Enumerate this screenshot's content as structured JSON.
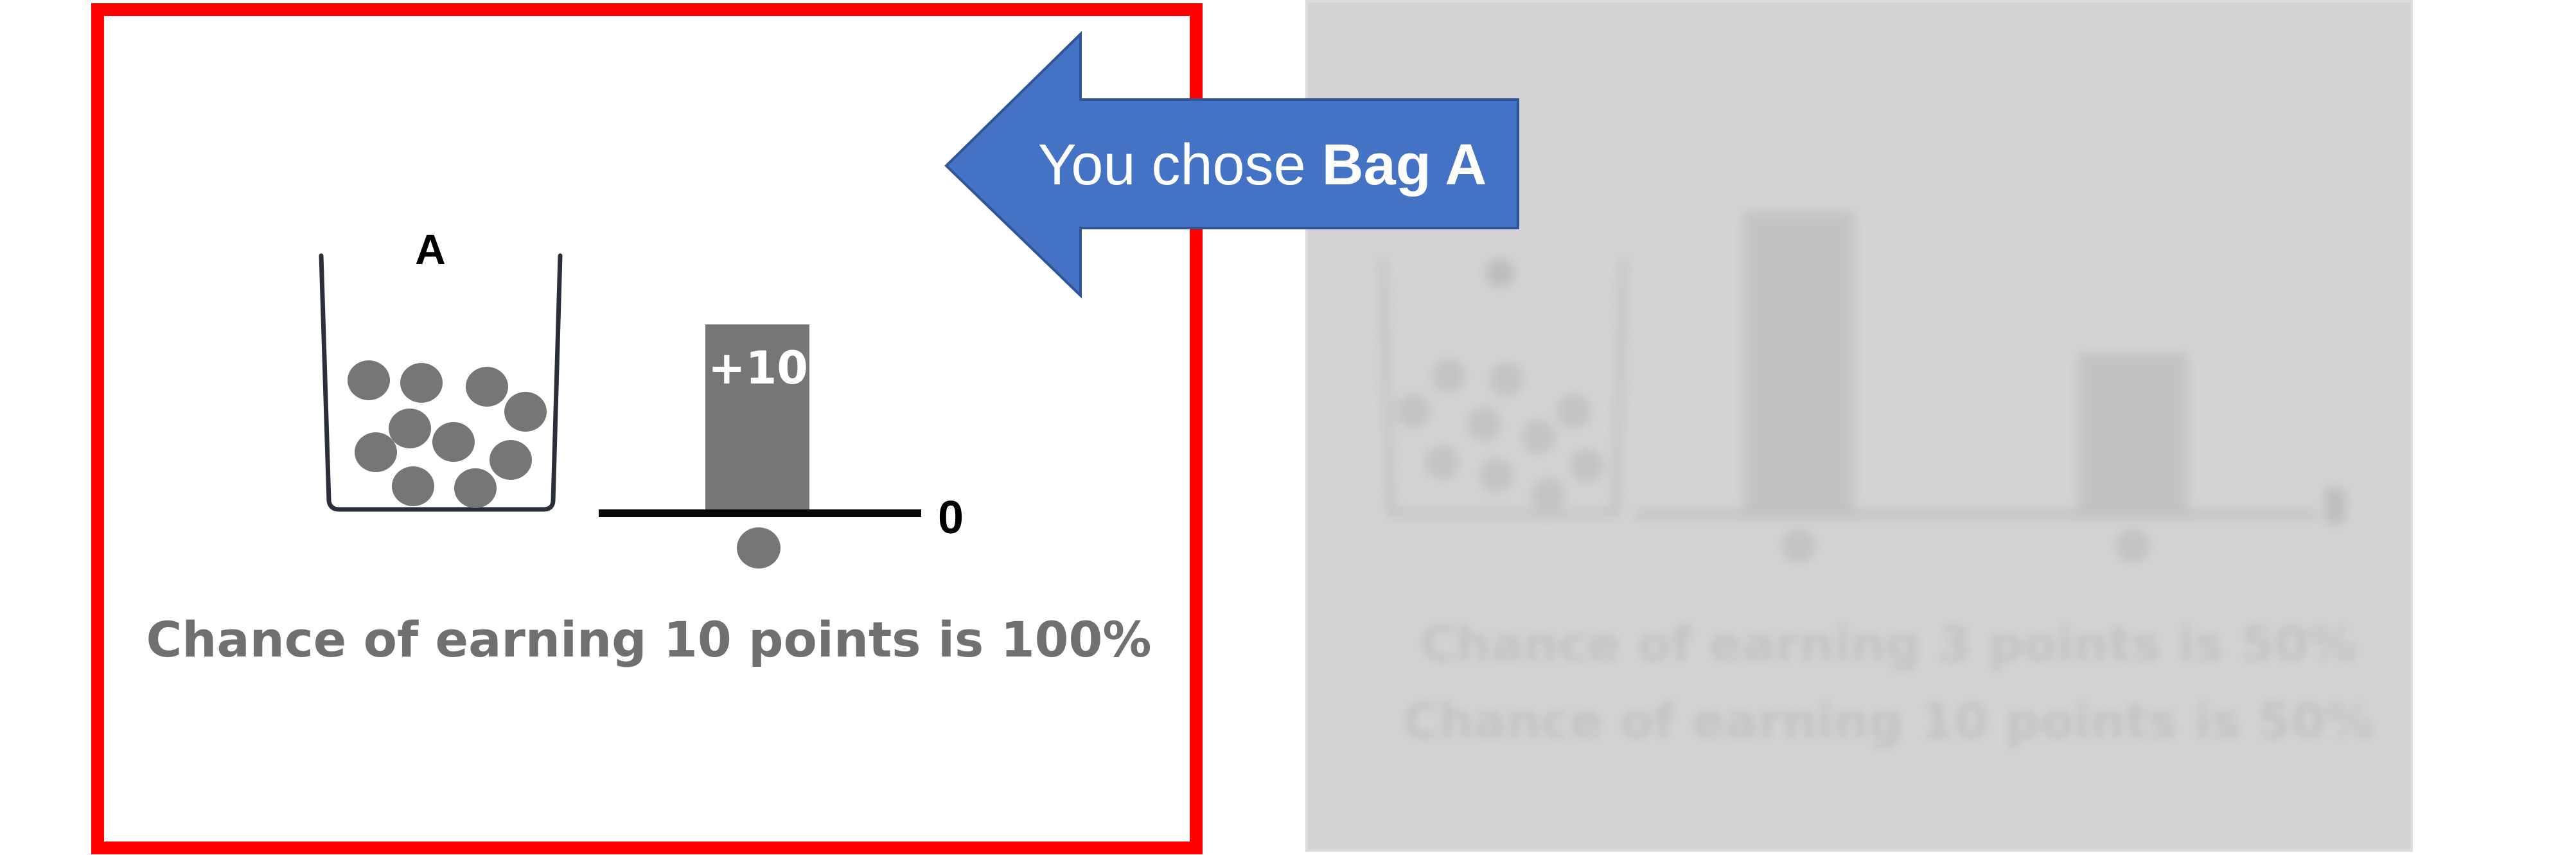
{
  "selected_option": {
    "bag_label": "A",
    "outcome_bar_label": "+10",
    "baseline_label": "0",
    "caption": "Chance of earning 10 points is 100%",
    "balls_in_bag": 10,
    "outcome_probability_percent": 100
  },
  "choice_arrow": {
    "prefix": "You chose ",
    "choice": "Bag A",
    "color": "#4472c4"
  },
  "other_option": {
    "state": "dimmed",
    "blurred_lines": [
      "Chance of earning 3 points is 50%",
      "Chance of earning 10 points is 50%"
    ]
  },
  "colors": {
    "selection_border": "#ff0000",
    "ball": "#767676",
    "bar": "#767676",
    "caption": "#707070",
    "dimmed_panel": "#d4d2d4"
  }
}
